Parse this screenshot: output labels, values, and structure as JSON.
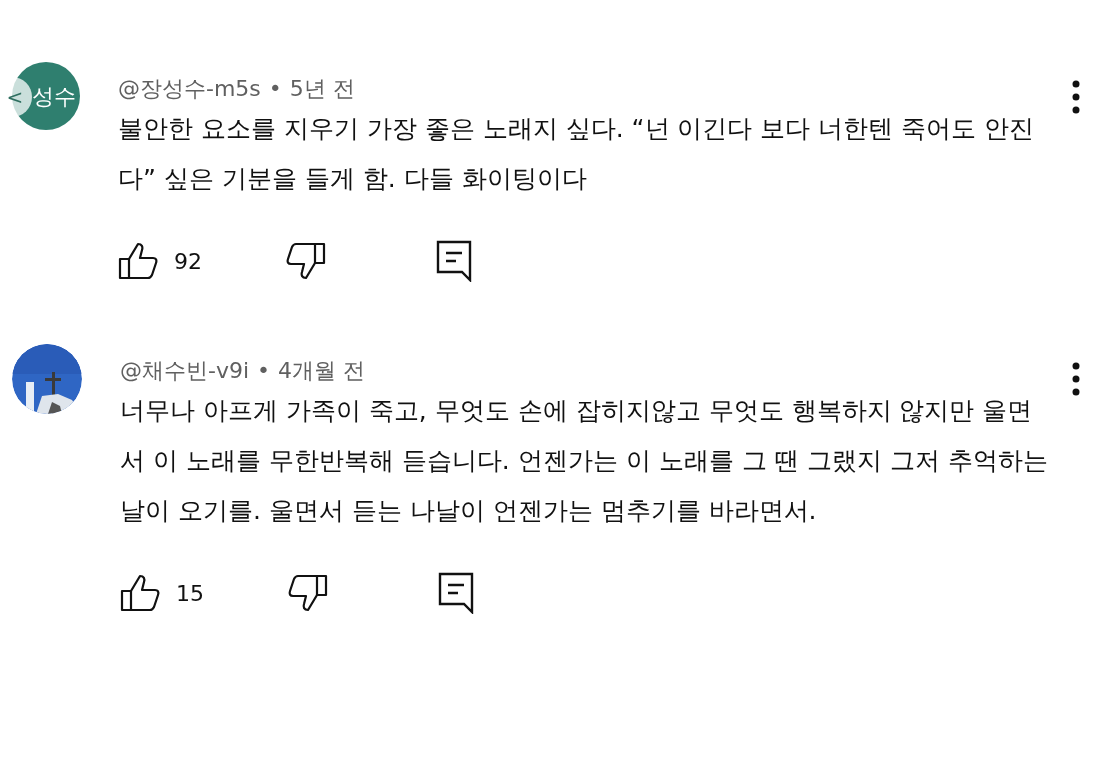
{
  "back_button": {
    "label": "<"
  },
  "separator": "•",
  "comments": [
    {
      "avatar": {
        "kind": "initials",
        "text": "성수",
        "color": "#2f7f6f"
      },
      "author": "@장성수-m5s",
      "time": "5년 전",
      "text": "불안한 요소를 지우기 가장 좋은 노래지 싶다. “넌 이긴다 보다 너한텐 죽어도 안진다” 싶은 기분을 들게 함. 다들 화이팅이다",
      "likes": "92"
    },
    {
      "author": "@채수빈-v9i",
      "time": "4개월 전",
      "text": "너무나 아프게 가족이 죽고, 무엇도 손에 잡히지않고 무엇도 행복하지 않지만 울면서 이 노래를 무한반복해 듣습니다. 언젠가는 이 노래를 그 땐 그랬지 그저 추억하는 날이 오기를. 울면서 듣는 나날이 언젠가는 멈추기를 바라면서.",
      "likes": "15"
    }
  ]
}
